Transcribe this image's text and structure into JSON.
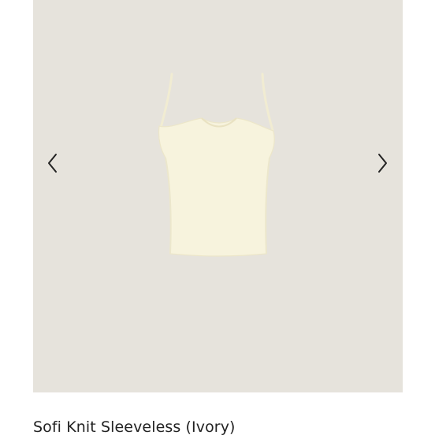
{
  "product": {
    "title": "Sofi Knit Sleeveless (Ivory)",
    "image_alt": "Ivory knit sleeveless camisole top"
  },
  "gallery": {
    "prev_icon": "chevron-left-icon",
    "next_icon": "chevron-right-icon"
  },
  "colors": {
    "gallery_background": "#e6e3dc",
    "garment": "#f7f3dd",
    "arrow": "#222222"
  }
}
